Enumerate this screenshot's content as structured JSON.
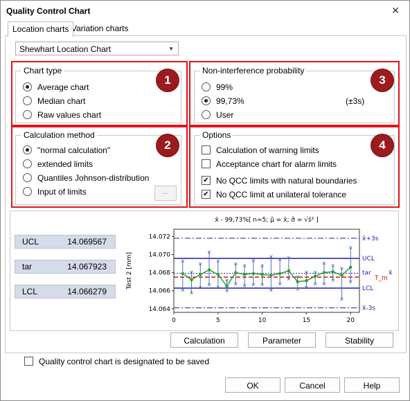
{
  "window": {
    "title": "Quality Control Chart",
    "close_glyph": "✕"
  },
  "tabs": [
    "Location charts",
    "Variation charts"
  ],
  "chart_select": {
    "value": "Shewhart Location Chart",
    "arrow": "▼"
  },
  "sections": {
    "chart_type": {
      "label": "Chart type",
      "badge": "1",
      "options": [
        "Average chart",
        "Median chart",
        "Raw values chart"
      ],
      "selected": 0
    },
    "calculation_method": {
      "label": "Calculation method",
      "badge": "2",
      "options": [
        "\"normal calculation\"",
        "extended limits",
        "Quantiles Johnson-distribution",
        "Input of limits"
      ],
      "selected": 0,
      "dots_button": "..."
    },
    "probability": {
      "label": "Non-interference probability",
      "badge": "3",
      "options": [
        "99%",
        "99,73%",
        "User"
      ],
      "selected": 1,
      "sigma_note": "(±3s)"
    },
    "options": {
      "label": "Options",
      "badge": "4",
      "checks": [
        {
          "label": "Calculation of warning limits",
          "checked": false
        },
        {
          "label": "Acceptance chart for alarm limits",
          "checked": false
        },
        {
          "label": "No QCC limits with natural boundaries",
          "checked": true
        },
        {
          "label": "No QCC limit at unilateral tolerance",
          "checked": true
        }
      ]
    }
  },
  "limits": {
    "ucl": {
      "label": "UCL",
      "value": "14.069567"
    },
    "tar": {
      "label": "tar",
      "value": "14.067923"
    },
    "lcl": {
      "label": "LCL",
      "value": "14.066279"
    }
  },
  "chart_data": {
    "type": "line",
    "title": "x̄ - 99,73%[ n=5; μ̂ = x̄; σ̂ = √s̄² ]",
    "ylabel": "Test 2 [mm]",
    "xlim": [
      0,
      21
    ],
    "ylim": [
      14.0636,
      14.0728
    ],
    "xticks": [
      0,
      5,
      10,
      15,
      20
    ],
    "yticks": [
      14.064,
      14.066,
      14.068,
      14.07,
      14.072
    ],
    "ytick_labels": [
      "14.064",
      "14.066",
      "14.068",
      "14.070",
      "14.072"
    ],
    "lines": [
      {
        "name": "x̄+3s",
        "value": 14.0718,
        "style": "dashdot",
        "color": "#1c1cb0"
      },
      {
        "name": "UCL",
        "value": 14.069567,
        "style": "solid",
        "color": "#1c1cb0"
      },
      {
        "name": "tar",
        "value": 14.067923,
        "style": "dotted",
        "color": "#1c1cb0"
      },
      {
        "name": "T_m",
        "value": 14.0675,
        "style": "dashed",
        "color": "#d01010"
      },
      {
        "name": "LCL",
        "value": 14.066279,
        "style": "solid",
        "color": "#1c1cb0"
      },
      {
        "name": "x̄-3s",
        "value": 14.0641,
        "style": "dashdot",
        "color": "#1c1cb0"
      }
    ],
    "right_labels": {
      "top": "x̄+3s",
      "ucl": "UCL",
      "tar": "tar",
      "tm": "T_m",
      "xbar": "x̄",
      "lcl": "LCL",
      "bottom": "x̄-3s"
    },
    "x": [
      1,
      2,
      3,
      4,
      5,
      6,
      7,
      8,
      9,
      10,
      11,
      12,
      13,
      14,
      15,
      16,
      17,
      18,
      19,
      20
    ],
    "means": [
      14.0679,
      14.0672,
      14.0678,
      14.0683,
      14.0678,
      14.0665,
      14.068,
      14.0678,
      14.0679,
      14.0678,
      14.0677,
      14.0679,
      14.0682,
      14.067,
      14.0671,
      14.0676,
      14.068,
      14.0681,
      14.0677,
      14.0686
    ],
    "ranges": [
      [
        14.0661,
        14.0693
      ],
      [
        14.0658,
        14.0681
      ],
      [
        14.0664,
        14.069
      ],
      [
        14.0667,
        14.0703
      ],
      [
        14.0664,
        14.0693
      ],
      [
        14.066,
        14.0672
      ],
      [
        14.0668,
        14.069
      ],
      [
        14.0666,
        14.0688
      ],
      [
        14.0667,
        14.0694
      ],
      [
        14.0667,
        14.0688
      ],
      [
        14.0661,
        14.0698
      ],
      [
        14.0668,
        14.0695
      ],
      [
        14.0673,
        14.0697
      ],
      [
        14.0662,
        14.0676
      ],
      [
        14.0664,
        14.0681
      ],
      [
        14.0668,
        14.0681
      ],
      [
        14.0668,
        14.0691
      ],
      [
        14.0672,
        14.0688
      ],
      [
        14.0651,
        14.0685
      ],
      [
        14.067,
        14.0708
      ]
    ]
  },
  "buttons": {
    "calculation": "Calculation",
    "parameter": "Parameter",
    "stability": "Stability",
    "ok": "OK",
    "cancel": "Cancel",
    "help": "Help"
  },
  "save_checkbox": {
    "label": "Quality control chart is designated to be saved",
    "checked": false
  },
  "colors": {
    "red_highlight": "#e0151d",
    "badge": "#9b1b1e",
    "limit_line": "#1c1cb0",
    "mean_line": "#2ca02c",
    "target_line": "#d01010"
  }
}
